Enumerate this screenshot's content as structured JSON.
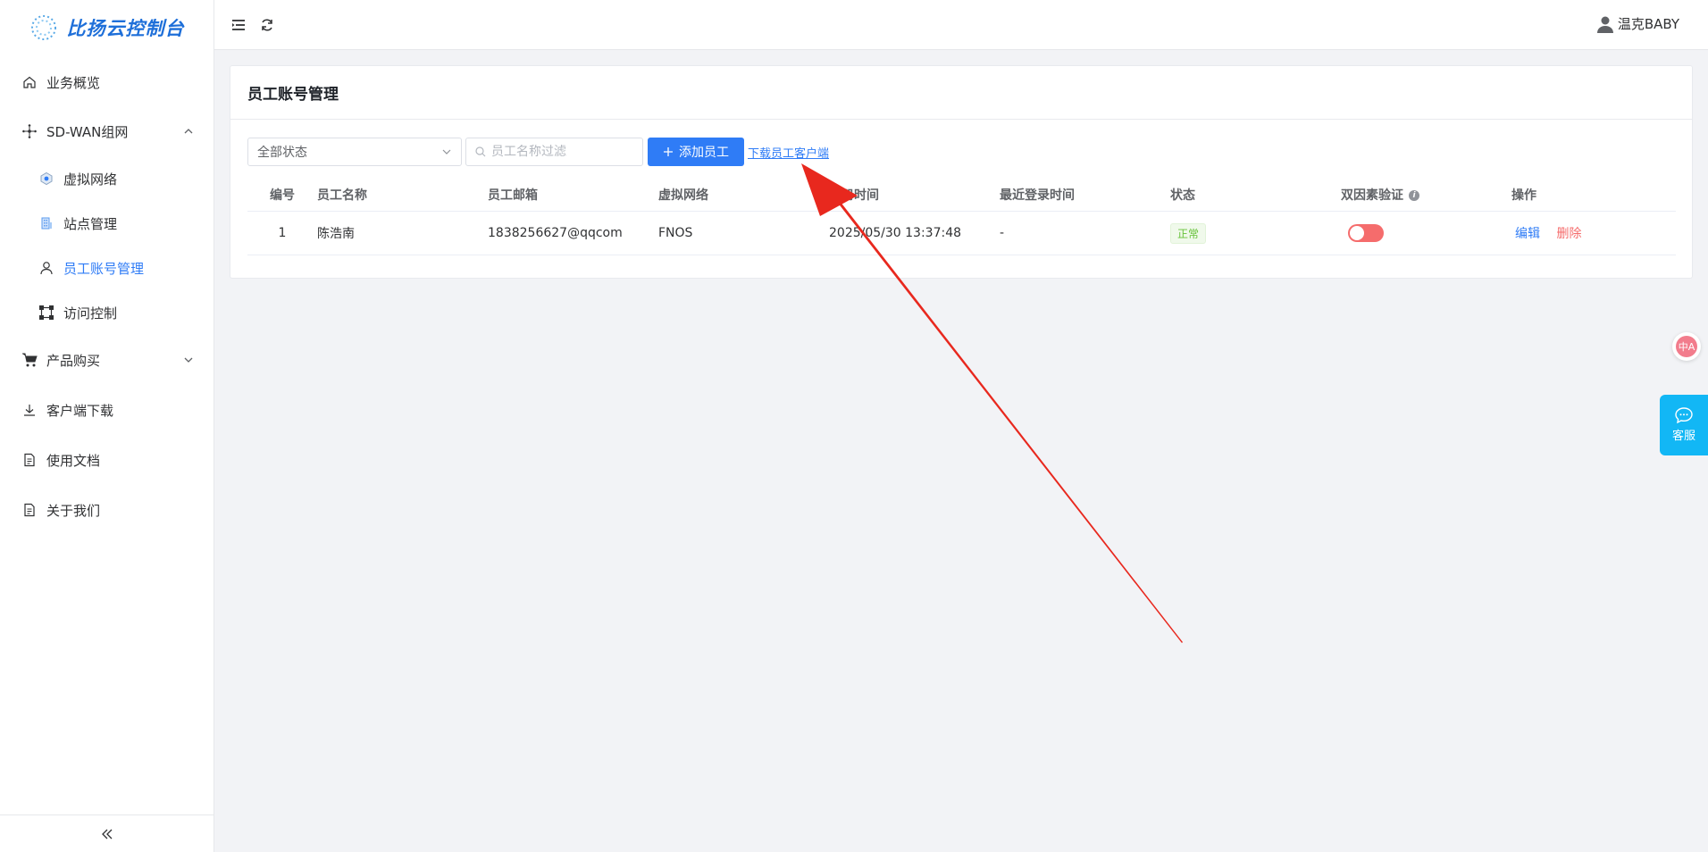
{
  "app": {
    "title": "比扬云控制台"
  },
  "sidebar": {
    "items": [
      {
        "label": "业务概览",
        "icon": "home-icon"
      },
      {
        "label": "SD-WAN组网",
        "icon": "network-icon"
      },
      {
        "label": "虚拟网络",
        "icon": "hexagon-icon"
      },
      {
        "label": "站点管理",
        "icon": "building-icon"
      },
      {
        "label": "员工账号管理",
        "icon": "user-icon"
      },
      {
        "label": "访问控制",
        "icon": "nodes-icon"
      },
      {
        "label": "产品购买",
        "icon": "cart-icon"
      },
      {
        "label": "客户端下载",
        "icon": "download-icon"
      },
      {
        "label": "使用文档",
        "icon": "document-icon"
      },
      {
        "label": "关于我们",
        "icon": "document-icon"
      }
    ]
  },
  "header": {
    "user": "温克BABY"
  },
  "page": {
    "title": "员工账号管理",
    "status_filter": "全部状态",
    "search_placeholder": "员工名称过滤",
    "add_button": "添加员工",
    "download_link": "下载员工客户端"
  },
  "table": {
    "columns": [
      "编号",
      "员工名称",
      "员工邮箱",
      "虚拟网络",
      "注册时间",
      "最近登录时间",
      "状态",
      "双因素验证",
      "操作"
    ],
    "rows": [
      {
        "id": "1",
        "name": "陈浩南",
        "email": "1838256627@qqcom",
        "network": "FNOS",
        "registered": "2025/05/30 13:37:48",
        "last_login": "-",
        "status": "正常",
        "two_factor": false,
        "edit": "编辑",
        "delete": "删除"
      }
    ]
  },
  "float": {
    "service": "客服",
    "translate": "中A"
  },
  "colors": {
    "primary": "#2f7cf6",
    "danger": "#f56c6c",
    "success": "#67c23a",
    "service": "#12b7f5",
    "annotation": "#e8281e"
  }
}
